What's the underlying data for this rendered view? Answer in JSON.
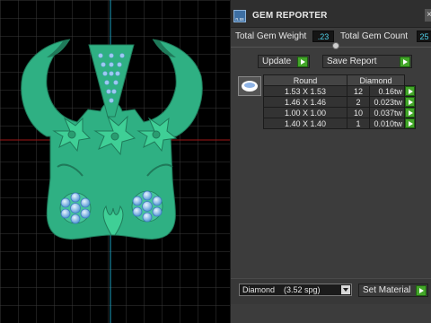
{
  "panel": {
    "title": "GEM REPORTER",
    "app_icon_label": "n.ss",
    "close_glyph": "×",
    "total_weight_label": "Total Gem Weight",
    "total_weight_value": ".23",
    "total_count_label": "Total Gem Count",
    "total_count_value": "25",
    "update_label": "Update",
    "save_report_label": "Save Report",
    "table": {
      "headers": [
        "Round",
        "Diamond"
      ],
      "rows": [
        {
          "size": "1.53 X 1.53",
          "count": "12",
          "weight": "0.16tw"
        },
        {
          "size": "1.46 X 1.46",
          "count": "2",
          "weight": "0.023tw"
        },
        {
          "size": "1.00 X 1.00",
          "count": "10",
          "weight": "0.037tw"
        },
        {
          "size": "1.40 X 1.40",
          "count": "1",
          "weight": "0.010tw"
        }
      ]
    },
    "material_select": "Diamond    (3.52 spg)",
    "set_material_label": "Set Material"
  },
  "colors": {
    "jewel_green": "#2fb083",
    "gem_blue": "#9ec9f0",
    "value_cyan": "#4fd0e8",
    "button_green": "#43a629"
  }
}
